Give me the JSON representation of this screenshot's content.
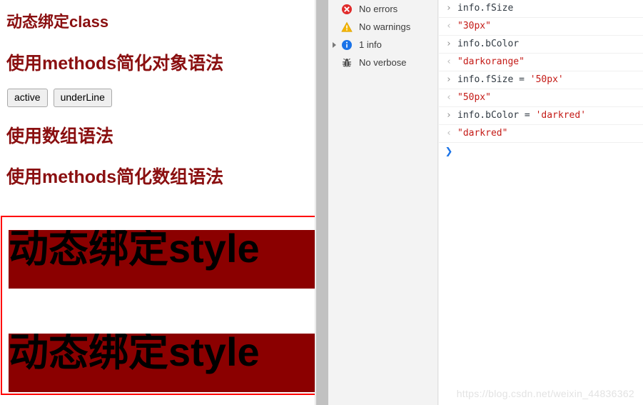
{
  "page": {
    "headings": [
      {
        "text": "动态绑定class"
      },
      {
        "text": "使用methods简化对象语法"
      },
      {
        "text": "使用数组语法"
      },
      {
        "text": "使用methods简化数组语法"
      }
    ],
    "buttons": [
      {
        "label": "active"
      },
      {
        "label": "underLine"
      }
    ],
    "style_demo": {
      "lines": [
        {
          "text": "动态绑定style"
        },
        {
          "text": "动态绑定style"
        }
      ],
      "background_color": "#8b0000",
      "text_color": "#000000",
      "font_size": "50px",
      "annotation_color": "#ff0000"
    },
    "heading_color": "#8a0f10"
  },
  "devtools": {
    "sidebar": {
      "filters": [
        {
          "icon": "error-icon",
          "label": "No errors",
          "expandable": false,
          "color": "#e02b2b"
        },
        {
          "icon": "warning-icon",
          "label": "No warnings",
          "expandable": false,
          "color": "#f4b400"
        },
        {
          "icon": "info-icon",
          "label": "1 info",
          "expandable": true,
          "color": "#1a73e8"
        },
        {
          "icon": "verbose-bug-icon",
          "label": "No verbose",
          "expandable": false,
          "color": "#5f6368"
        }
      ]
    },
    "console": {
      "messages": [
        {
          "kind": "input",
          "sigil": "›",
          "segments": [
            {
              "t": "info.fSize",
              "c": "code"
            }
          ]
        },
        {
          "kind": "output",
          "sigil": "‹",
          "segments": [
            {
              "t": "\"30px\"",
              "c": "tokstr"
            }
          ]
        },
        {
          "kind": "input",
          "sigil": "›",
          "segments": [
            {
              "t": "info.bColor",
              "c": "code"
            }
          ]
        },
        {
          "kind": "output",
          "sigil": "‹",
          "segments": [
            {
              "t": "\"darkorange\"",
              "c": "tokstr"
            }
          ]
        },
        {
          "kind": "input",
          "sigil": "›",
          "segments": [
            {
              "t": "info.fSize",
              "c": "code"
            },
            {
              "t": " = ",
              "c": "tokop"
            },
            {
              "t": "'50px'",
              "c": "tokstr"
            }
          ]
        },
        {
          "kind": "output",
          "sigil": "‹",
          "segments": [
            {
              "t": "\"50px\"",
              "c": "tokstr"
            }
          ]
        },
        {
          "kind": "input",
          "sigil": "›",
          "segments": [
            {
              "t": "info.bColor",
              "c": "code"
            },
            {
              "t": " = ",
              "c": "tokop"
            },
            {
              "t": "'darkred'",
              "c": "tokstr"
            }
          ]
        },
        {
          "kind": "output",
          "sigil": "‹",
          "segments": [
            {
              "t": "\"darkred\"",
              "c": "tokstr"
            }
          ]
        },
        {
          "kind": "prompt",
          "sigil": "❯",
          "segments": []
        }
      ],
      "highlight_color": "#ff0000"
    }
  },
  "watermark": {
    "text": "https://blog.csdn.net/weixin_44836362"
  }
}
